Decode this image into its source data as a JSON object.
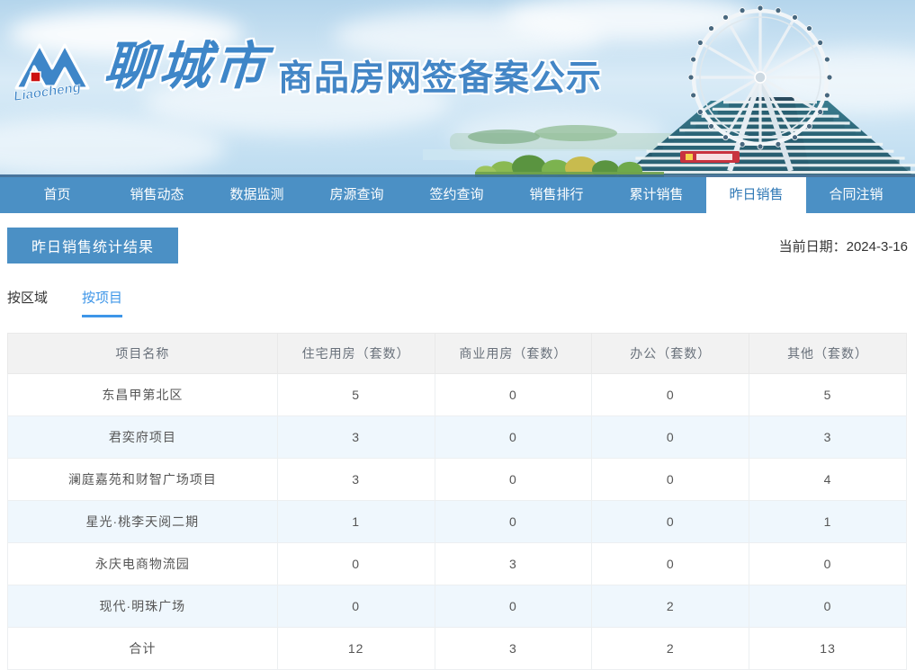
{
  "banner": {
    "logo_script": "Liaocheng",
    "city": "聊城市",
    "title": "商品房网签备案公示"
  },
  "nav": {
    "items": [
      {
        "label": "首页",
        "active": false
      },
      {
        "label": "销售动态",
        "active": false
      },
      {
        "label": "数据监测",
        "active": false
      },
      {
        "label": "房源查询",
        "active": false
      },
      {
        "label": "签约查询",
        "active": false
      },
      {
        "label": "销售排行",
        "active": false
      },
      {
        "label": "累计销售",
        "active": false
      },
      {
        "label": "昨日销售",
        "active": true
      },
      {
        "label": "合同注销",
        "active": false
      }
    ]
  },
  "page": {
    "section_title": "昨日销售统计结果",
    "date_label": "当前日期：",
    "date_value": "2024-3-16",
    "tabs": [
      {
        "label": "按区域",
        "active": false
      },
      {
        "label": "按项目",
        "active": true
      }
    ]
  },
  "chart_data": {
    "type": "table",
    "title": "昨日销售统计结果（按项目）",
    "headers": [
      "项目名称",
      "住宅用房（套数）",
      "商业用房（套数）",
      "办公（套数）",
      "其他（套数）"
    ],
    "rows": [
      [
        "东昌甲第北区",
        "5",
        "0",
        "0",
        "5"
      ],
      [
        "君奕府项目",
        "3",
        "0",
        "0",
        "3"
      ],
      [
        "澜庭嘉苑和财智广场项目",
        "3",
        "0",
        "0",
        "4"
      ],
      [
        "星光·桃李天阅二期",
        "1",
        "0",
        "0",
        "1"
      ],
      [
        "永庆电商物流园",
        "0",
        "3",
        "0",
        "0"
      ],
      [
        "现代·明珠广场",
        "0",
        "0",
        "2",
        "0"
      ],
      [
        "合计",
        "12",
        "3",
        "2",
        "13"
      ]
    ]
  },
  "colors": {
    "nav_blue": "#4b90c5",
    "nav_active_text": "#3079b6",
    "badge_blue": "#4b90c5",
    "tab_active_blue": "#3e96e8",
    "table_header_bg": "#f2f2f2",
    "row_alt_bg": "#eff7fd",
    "brand_blue": "#3e86c8",
    "logo_red": "#cc1111"
  }
}
